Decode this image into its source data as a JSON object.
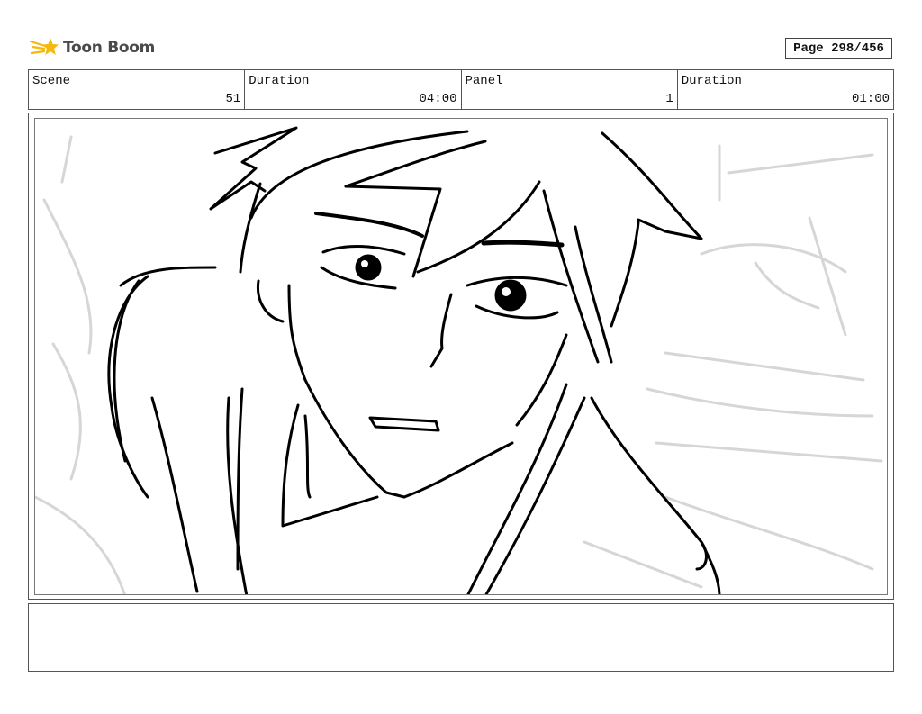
{
  "brand": {
    "name": "Toon Boom",
    "logo_icon": "comet-star-icon",
    "logo_color": "#f5b80c"
  },
  "page_indicator": "Page 298/456",
  "header": {
    "scene_label": "Scene",
    "scene_value": "51",
    "scene_duration_label": "Duration",
    "scene_duration_value": "04:00",
    "panel_label": "Panel",
    "panel_value": "1",
    "panel_duration_label": "Duration",
    "panel_duration_value": "01:00"
  },
  "panel": {
    "content": "storyboard-sketch-character-closeup"
  },
  "notes": {
    "text": ""
  }
}
